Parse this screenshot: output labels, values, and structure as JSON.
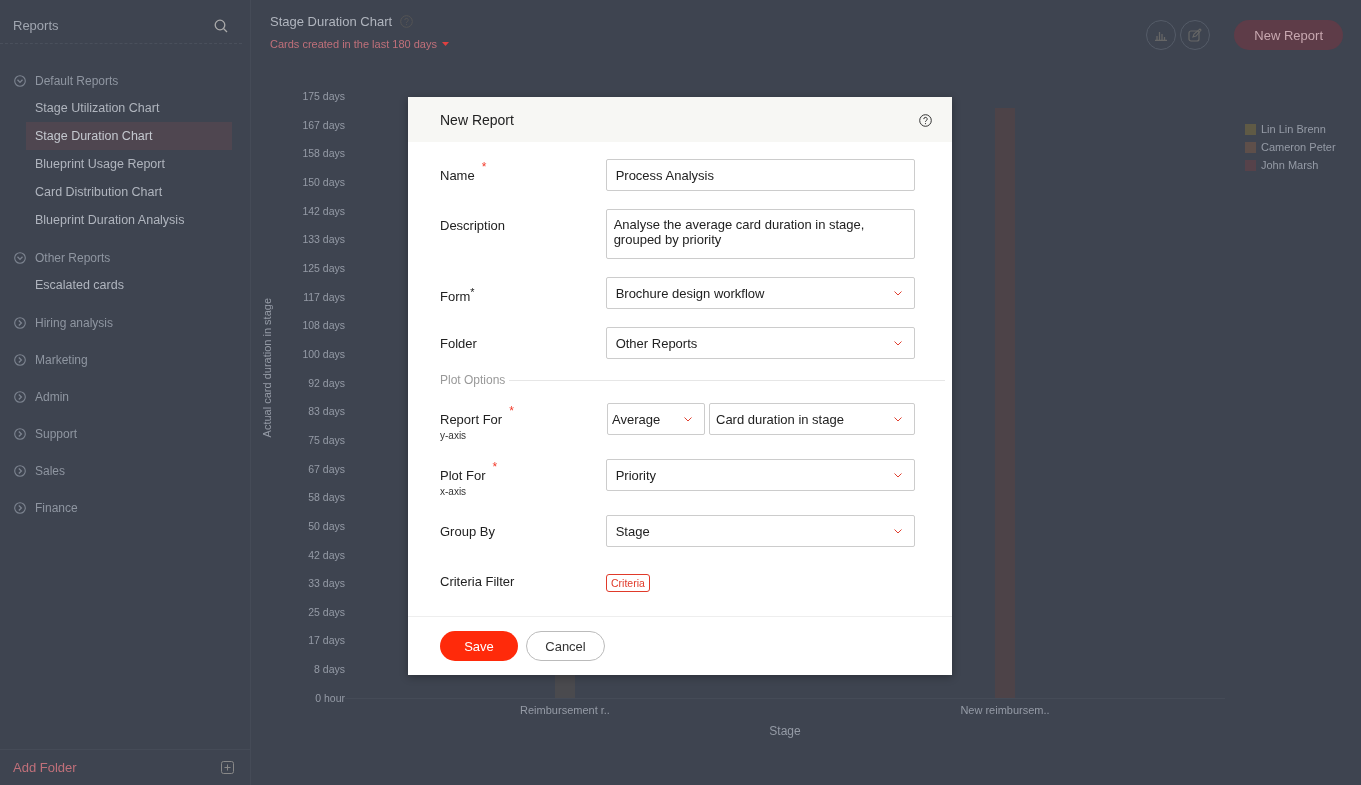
{
  "sidebar": {
    "title": "Reports",
    "folders": [
      {
        "name": "Default Reports",
        "expanded": true,
        "items": [
          {
            "label": "Stage Utilization Chart",
            "selected": false
          },
          {
            "label": "Stage Duration Chart",
            "selected": true
          },
          {
            "label": "Blueprint Usage Report",
            "selected": false
          },
          {
            "label": "Card Distribution Chart",
            "selected": false
          },
          {
            "label": "Blueprint Duration Analysis",
            "selected": false
          }
        ]
      },
      {
        "name": "Other Reports",
        "expanded": true,
        "items": [
          {
            "label": "Escalated cards",
            "selected": false
          }
        ]
      },
      {
        "name": "Hiring analysis",
        "expanded": false
      },
      {
        "name": "Marketing",
        "expanded": false
      },
      {
        "name": "Admin",
        "expanded": false
      },
      {
        "name": "Support",
        "expanded": false
      },
      {
        "name": "Sales",
        "expanded": false
      },
      {
        "name": "Finance",
        "expanded": false
      }
    ],
    "add_folder": "Add Folder"
  },
  "header": {
    "title": "Stage Duration Chart",
    "filter": "Cards created in the last 180 days",
    "new_report": "New Report"
  },
  "chart": {
    "ylabel": "Actual card duration in stage",
    "yticks": [
      "175 days",
      "167 days",
      "158 days",
      "150 days",
      "142 days",
      "133 days",
      "125 days",
      "117 days",
      "108 days",
      "100 days",
      "92 days",
      "83 days",
      "75 days",
      "67 days",
      "58 days",
      "50 days",
      "42 days",
      "33 days",
      "25 days",
      "17 days",
      "8 days",
      "0 hour"
    ],
    "categories": [
      "Reimbursement r..",
      "New reimbursem.."
    ],
    "xlabel": "Stage",
    "legend": [
      {
        "name": "Lin Lin Brenn",
        "color": "#5f5a45"
      },
      {
        "name": "Cameron Peter",
        "color": "#5e4f4a"
      },
      {
        "name": "John Marsh",
        "color": "#56424a"
      }
    ]
  },
  "dialog": {
    "title": "New Report",
    "fields": [
      {
        "kind": "text",
        "label": "Name",
        "required_mark": "*",
        "value": "Process Analysis"
      },
      {
        "kind": "textarea",
        "label": "Description",
        "value": "Analyse the average card duration in stage, grouped by priority"
      },
      {
        "kind": "select",
        "label": "Form$^{*}$",
        "value": "Brochure design workflow"
      },
      {
        "kind": "select",
        "label": "Folder",
        "value": "Other Reports"
      },
      {
        "kind": "section",
        "label": "Plot Options"
      },
      {
        "kind": "select-pair",
        "label": "Report For",
        "sublabel": "y-axis",
        "required_mark": "*",
        "values": [
          "Average",
          "Card duration in stage"
        ]
      },
      {
        "kind": "select",
        "label": "Plot For",
        "sublabel": "x-axis",
        "required_mark": "*",
        "value": "Priority"
      },
      {
        "kind": "select",
        "label": "Group By",
        "value": "Stage"
      },
      {
        "kind": "tag",
        "label": "Criteria Filter",
        "value": "Criteria"
      }
    ],
    "save": "Save",
    "cancel": "Cancel"
  }
}
